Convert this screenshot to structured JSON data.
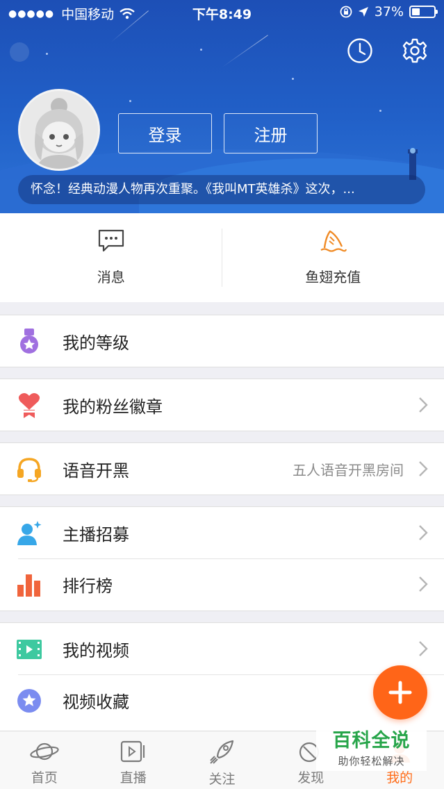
{
  "status_bar": {
    "carrier": "中国移动",
    "time": "下午8:49",
    "battery": "37%"
  },
  "header": {
    "login_label": "登录",
    "register_label": "注册",
    "ticker": "怀念！经典动漫人物再次重聚。《我叫MT英雄杀》这次，..."
  },
  "quick_actions": [
    {
      "label": "消息",
      "icon": "chat-bubble-icon"
    },
    {
      "label": "鱼翅充值",
      "icon": "shark-fin-icon"
    }
  ],
  "menu": {
    "level": {
      "label": "我的等级",
      "icon": "medal-icon"
    },
    "fan_badge": {
      "label": "我的粉丝徽章",
      "icon": "heart-badge-icon"
    },
    "voice": {
      "label": "语音开黑",
      "sub": "五人语音开黑房间",
      "icon": "headset-icon"
    },
    "recruit": {
      "label": "主播招募",
      "icon": "streamer-recruit-icon"
    },
    "ranking": {
      "label": "排行榜",
      "icon": "bar-chart-icon"
    },
    "videos": {
      "label": "我的视频",
      "icon": "video-play-icon"
    },
    "favorites": {
      "label": "视频收藏",
      "icon": "star-circle-icon"
    }
  },
  "tabs": [
    {
      "label": "首页",
      "icon": "planet-icon"
    },
    {
      "label": "直播",
      "icon": "live-play-icon"
    },
    {
      "label": "关注",
      "icon": "rocket-icon"
    },
    {
      "label": "发现",
      "icon": "discover-icon"
    },
    {
      "label": "我的",
      "icon": "profile-icon",
      "active": true
    }
  ],
  "watermark": {
    "title": "百科全说",
    "subtitle": "助你轻松解决"
  },
  "colors": {
    "accent": "#ff6518",
    "header_blue": "#2160c8",
    "watermark_green": "#27a54a"
  }
}
